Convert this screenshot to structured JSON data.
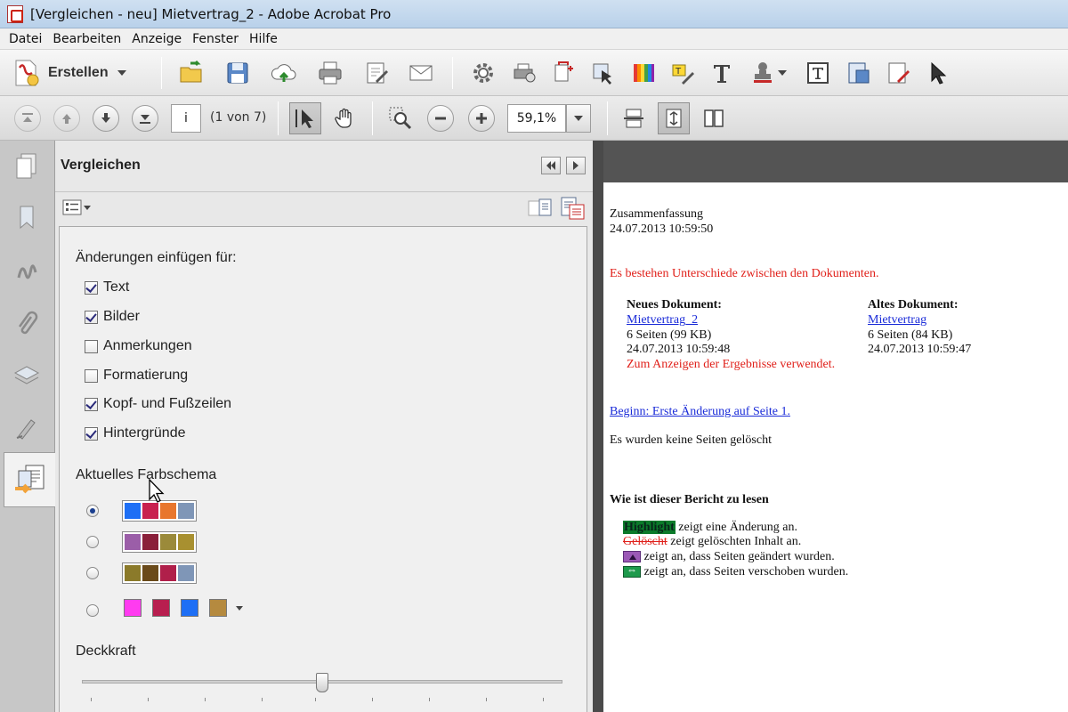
{
  "window": {
    "title": "[Vergleichen - neu] Mietvertrag_2 - Adobe Acrobat Pro"
  },
  "menu": [
    "Datei",
    "Bearbeiten",
    "Anzeige",
    "Fenster",
    "Hilfe"
  ],
  "toolbar": {
    "create_label": "Erstellen"
  },
  "nav": {
    "page_field": "i",
    "page_of": "(1 von 7)",
    "zoom": "59,1%"
  },
  "panel": {
    "title": "Vergleichen",
    "section_insert": "Änderungen einfügen für:",
    "options": [
      {
        "label": "Text",
        "checked": true
      },
      {
        "label": "Bilder",
        "checked": true
      },
      {
        "label": "Anmerkungen",
        "checked": false
      },
      {
        "label": "Formatierung",
        "checked": false
      },
      {
        "label": "Kopf- und Fußzeilen",
        "checked": true
      },
      {
        "label": "Hintergründe",
        "checked": true
      }
    ],
    "section_scheme": "Aktuelles Farbschema",
    "schemes": [
      {
        "selected": true,
        "colors": [
          "#1e6ff5",
          "#c8204f",
          "#e8762d",
          "#7f96b7"
        ]
      },
      {
        "selected": false,
        "colors": [
          "#9b5ea8",
          "#8a1f3a",
          "#9b8a3a",
          "#a89030"
        ]
      },
      {
        "selected": false,
        "colors": [
          "#8b7a2a",
          "#6a4a1a",
          "#b01f4a",
          "#7f96b7"
        ]
      },
      {
        "selected": false,
        "colors": [
          "#ff3bf0",
          "#b81f4f",
          "#1e6ff5",
          "#b58a3f"
        ]
      }
    ],
    "section_opacity": "Deckkraft",
    "opacity_fraction": 0.5
  },
  "report": {
    "summary": "Zusammenfassung",
    "summary_date": "24.07.2013 10:59:50",
    "differences": "Es bestehen Unterschiede zwischen den Dokumenten.",
    "new_doc": {
      "heading": "Neues Dokument:",
      "name": "Mietvertrag_2",
      "pages": "6 Seiten (99 KB)",
      "date": "24.07.2013 10:59:48",
      "note": "Zum Anzeigen der Ergebnisse verwendet."
    },
    "old_doc": {
      "heading": "Altes Dokument:",
      "name": "Mietvertrag",
      "pages": "6 Seiten (84 KB)",
      "date": "24.07.2013 10:59:47"
    },
    "first_change": "Beginn: Erste Änderung auf Seite 1.",
    "no_deleted": "Es wurden keine Seiten gelöscht",
    "howto_heading": "Wie ist dieser Bericht zu lesen",
    "legend": {
      "highlight_word": "Highlight",
      "highlight_text": "zeigt eine Änderung an.",
      "deleted_word": "Gelöscht",
      "deleted_text": "zeigt gelöschten Inhalt an.",
      "changed_text": "zeigt an, dass Seiten geändert wurden.",
      "moved_text": "zeigt an, dass Seiten verschoben wurden."
    }
  }
}
